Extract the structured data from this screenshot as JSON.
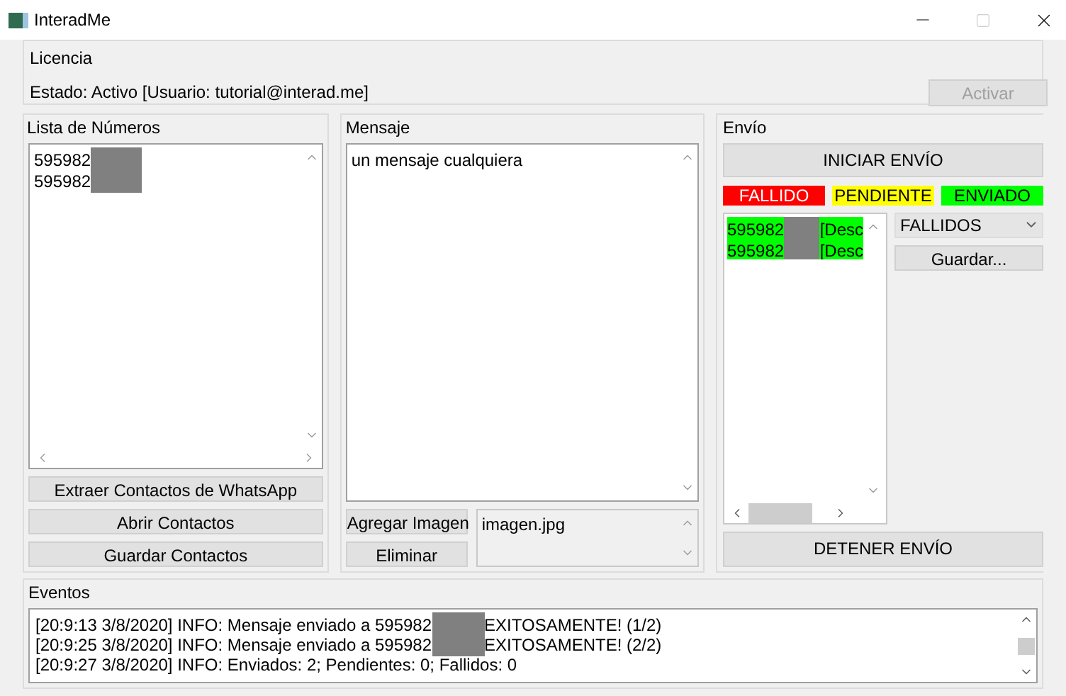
{
  "window": {
    "title": "InteradMe"
  },
  "license": {
    "title": "Licencia",
    "status": "Estado: Activo [Usuario: tutorial@interad.me]",
    "activate_button": {
      "label": "Activar",
      "disabled": true
    }
  },
  "numbers": {
    "title": "Lista de Números",
    "items": [
      {
        "text": "595982",
        "redacted": true
      },
      {
        "text": "595982",
        "redacted": true
      }
    ],
    "buttons": [
      "Extraer Contactos de WhatsApp",
      "Abrir Contactos",
      "Guardar Contactos"
    ]
  },
  "message": {
    "title": "Mensaje",
    "value": "un mensaje cualquiera",
    "add_image_button": "Agregar Imagen",
    "remove_button": "Eliminar",
    "images": [
      "imagen.jpg"
    ]
  },
  "sending": {
    "title": "Envío",
    "start_button": "INICIAR ENVÍO",
    "legend": [
      {
        "label": "FALLIDO",
        "color": "#ff0000"
      },
      {
        "label": "PENDIENTE",
        "color": "#ffff00"
      },
      {
        "label": "ENVIADO",
        "color": "#00ff00"
      }
    ],
    "results": [
      {
        "number": "595982",
        "redacted": true,
        "note": "[Desc",
        "color": "#00ff00"
      },
      {
        "number": "595982",
        "redacted": true,
        "note": "[Desc",
        "color": "#00ff00"
      }
    ],
    "filter": "FALLIDOS",
    "save_button": "Guardar...",
    "stop_button": "DETENER ENVÍO"
  },
  "events": {
    "title": "Eventos",
    "lines": [
      {
        "before": "[20:9:13 3/8/2020] INFO: Mensaje enviado a 595982",
        "redacted": true,
        "after": "EXITOSAMENTE! (1/2)"
      },
      {
        "before": "[20:9:25 3/8/2020] INFO: Mensaje enviado a 595982",
        "redacted": true,
        "after": "EXITOSAMENTE! (2/2)"
      },
      {
        "before": "[20:9:27 3/8/2020] INFO: Enviados: 2; Pendientes: 0; Fallidos: 0",
        "redacted": false
      }
    ]
  }
}
